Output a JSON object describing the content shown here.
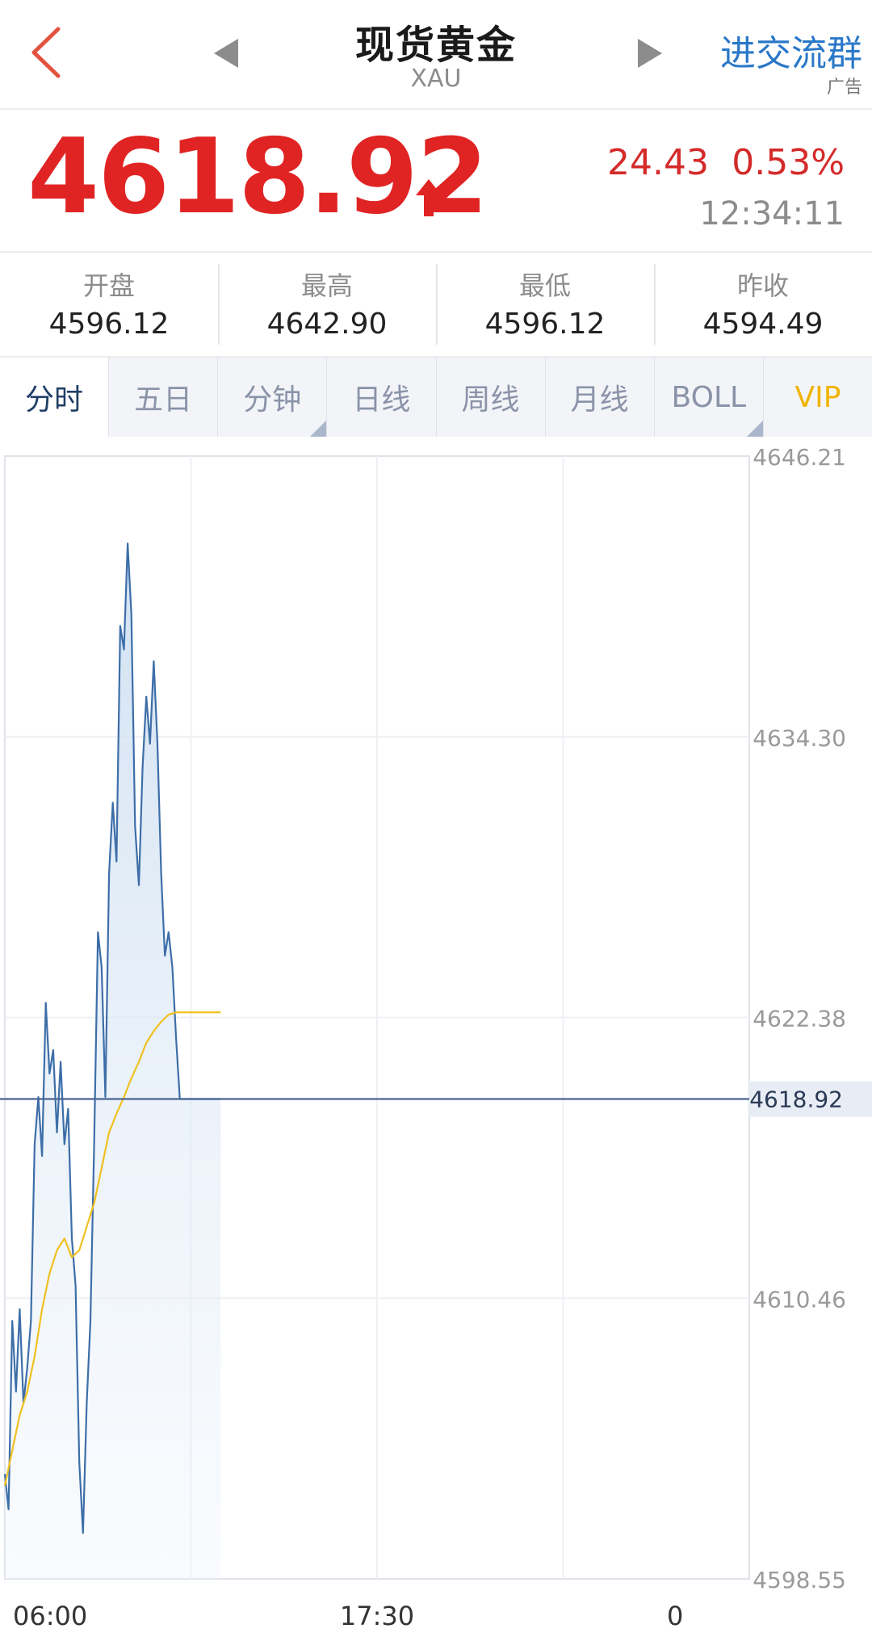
{
  "header": {
    "title": "现货黄金",
    "subtitle": "XAU",
    "group_label": "进交流群",
    "ad_label": "广告"
  },
  "quote": {
    "price": "4618.92",
    "change": "24.43",
    "change_pct": "0.53%",
    "time": "12:34:11"
  },
  "stats": [
    {
      "label": "开盘",
      "value": "4596.12"
    },
    {
      "label": "最高",
      "value": "4642.90"
    },
    {
      "label": "最低",
      "value": "4596.12"
    },
    {
      "label": "昨收",
      "value": "4594.49"
    }
  ],
  "tabs": [
    {
      "label": "分时",
      "active": true
    },
    {
      "label": "五日"
    },
    {
      "label": "分钟"
    },
    {
      "label": "日线"
    },
    {
      "label": "周线"
    },
    {
      "label": "月线"
    },
    {
      "label": "BOLL"
    },
    {
      "label": "VIP"
    }
  ],
  "colors": {
    "price_up": "#e02424",
    "link": "#2a78c8",
    "price_line": "#3d6ea8",
    "avg_line": "#f0c020",
    "vip": "#f0b400"
  },
  "icons": [
    "back-chevron-icon",
    "prev-arrow-icon",
    "next-arrow-icon",
    "up-arrow-icon"
  ],
  "chart_data": {
    "type": "line",
    "x_ticks": [
      "06:00",
      "17:30",
      "0"
    ],
    "y_ticks": [
      "4646.21",
      "4634.30",
      "4622.38",
      "4610.46",
      "4598.55"
    ],
    "ylim": [
      4598.55,
      4646.21
    ],
    "x_domain": [
      0,
      100
    ],
    "current_price": 4618.92,
    "current_label": "4618.92",
    "grid": true,
    "series": [
      {
        "role": "price",
        "x": [
          0,
          0.5,
          1,
          1.5,
          2,
          2.5,
          3,
          3.5,
          4,
          4.5,
          5,
          5.5,
          6,
          6.5,
          7,
          7.5,
          8,
          8.5,
          9,
          9.5,
          10,
          10.5,
          11,
          11.5,
          12,
          12.5,
          13,
          13.5,
          14,
          14.5,
          15,
          15.5,
          16,
          16.5,
          17,
          17.5,
          18,
          18.5,
          19,
          19.5,
          20,
          20.5,
          21,
          21.5,
          22,
          22.5,
          23,
          23.5,
          24,
          24.5,
          25,
          25.5,
          26,
          26.5,
          27,
          27.5,
          28,
          28.5,
          29
        ],
        "y": [
          4603.0,
          4601.5,
          4609.5,
          4606.5,
          4610.0,
          4606.0,
          4607.5,
          4609.5,
          4617.0,
          4619.0,
          4616.5,
          4623.0,
          4620.0,
          4621.0,
          4617.5,
          4620.5,
          4617.0,
          4618.5,
          4613.0,
          4611.0,
          4603.5,
          4600.5,
          4606.0,
          4609.5,
          4617.0,
          4626.0,
          4624.5,
          4619.0,
          4628.5,
          4631.5,
          4629.0,
          4639.0,
          4638.0,
          4642.5,
          4639.5,
          4630.5,
          4628.0,
          4633.0,
          4636.0,
          4634.0,
          4637.5,
          4634.0,
          4628.5,
          4625.0,
          4626.0,
          4624.5,
          4621.5,
          4618.92,
          4618.92,
          4618.92,
          4618.92,
          4618.92,
          4618.92,
          4618.92,
          4618.92,
          4618.92,
          4618.92,
          4618.92,
          4618.92
        ]
      },
      {
        "role": "average",
        "x": [
          0,
          1,
          2,
          3,
          4,
          5,
          6,
          7,
          8,
          9,
          10,
          11,
          12,
          13,
          14,
          15,
          16,
          17,
          18,
          19,
          20,
          21,
          22,
          23,
          24,
          25,
          26,
          27,
          28,
          29
        ],
        "y": [
          4602.5,
          4604.0,
          4605.5,
          4606.5,
          4608.0,
          4610.0,
          4611.5,
          4612.5,
          4613.0,
          4612.2,
          4612.5,
          4613.5,
          4614.5,
          4616.0,
          4617.5,
          4618.3,
          4619.0,
          4619.8,
          4620.5,
          4621.3,
          4621.8,
          4622.2,
          4622.5,
          4622.6,
          4622.6,
          4622.6,
          4622.6,
          4622.6,
          4622.6,
          4622.6
        ]
      }
    ]
  }
}
